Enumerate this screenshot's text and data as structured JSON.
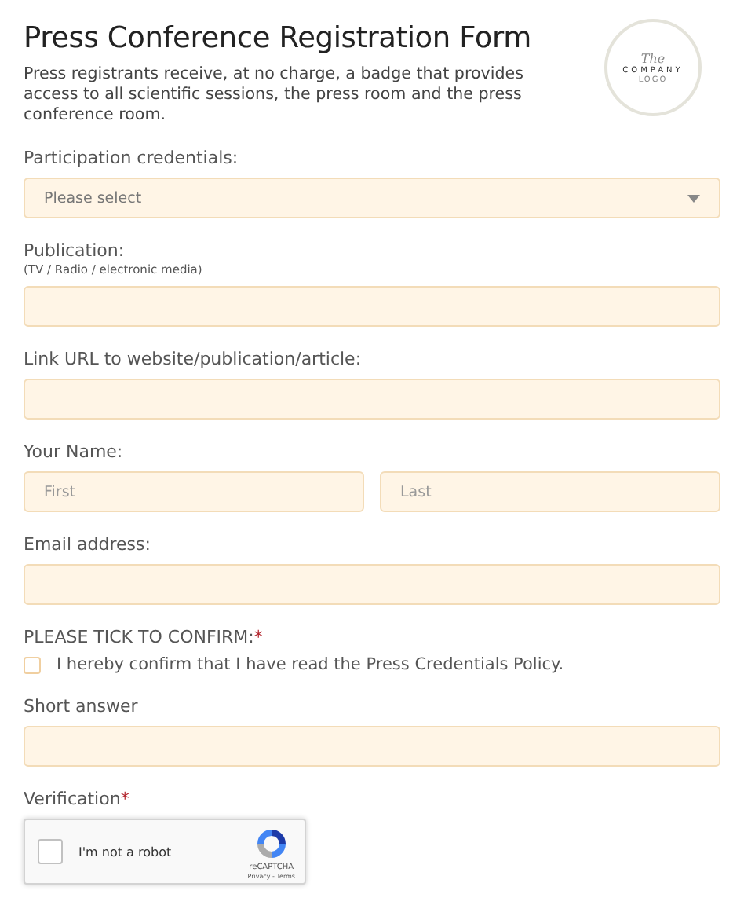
{
  "title": "Press Conference Registration Form",
  "logo": {
    "script": "The",
    "name": "COMPANY",
    "sub": "LOGO"
  },
  "description": "Press registrants receive, at no charge, a badge that provides access to all scientific sessions, the press room and the press conference room.",
  "fields": [
    {
      "kind": "select",
      "label": "Participation credentials:",
      "placeholder": "Please select"
    },
    {
      "kind": "text",
      "label": "Publication:",
      "hint": "(TV / Radio / electronic media)"
    },
    {
      "kind": "text",
      "label": "Link URL to website/publication/article:"
    },
    {
      "kind": "name",
      "label": "Your Name:",
      "placeholders": [
        "First",
        "Last"
      ]
    },
    {
      "kind": "text",
      "label": "Email address:"
    },
    {
      "kind": "checkbox",
      "label": "PLEASE TICK TO CONFIRM:",
      "option": "I hereby confirm that I have read the Press Credentials Policy.",
      "checked": false,
      "marker": "*"
    },
    {
      "kind": "text",
      "label": "Short answer"
    },
    {
      "kind": "captcha",
      "label": "Verification",
      "text": "I'm not a robot",
      "brand": "reCAPTCHA",
      "links": "Privacy - Terms",
      "checked": false,
      "marker": "*"
    }
  ]
}
